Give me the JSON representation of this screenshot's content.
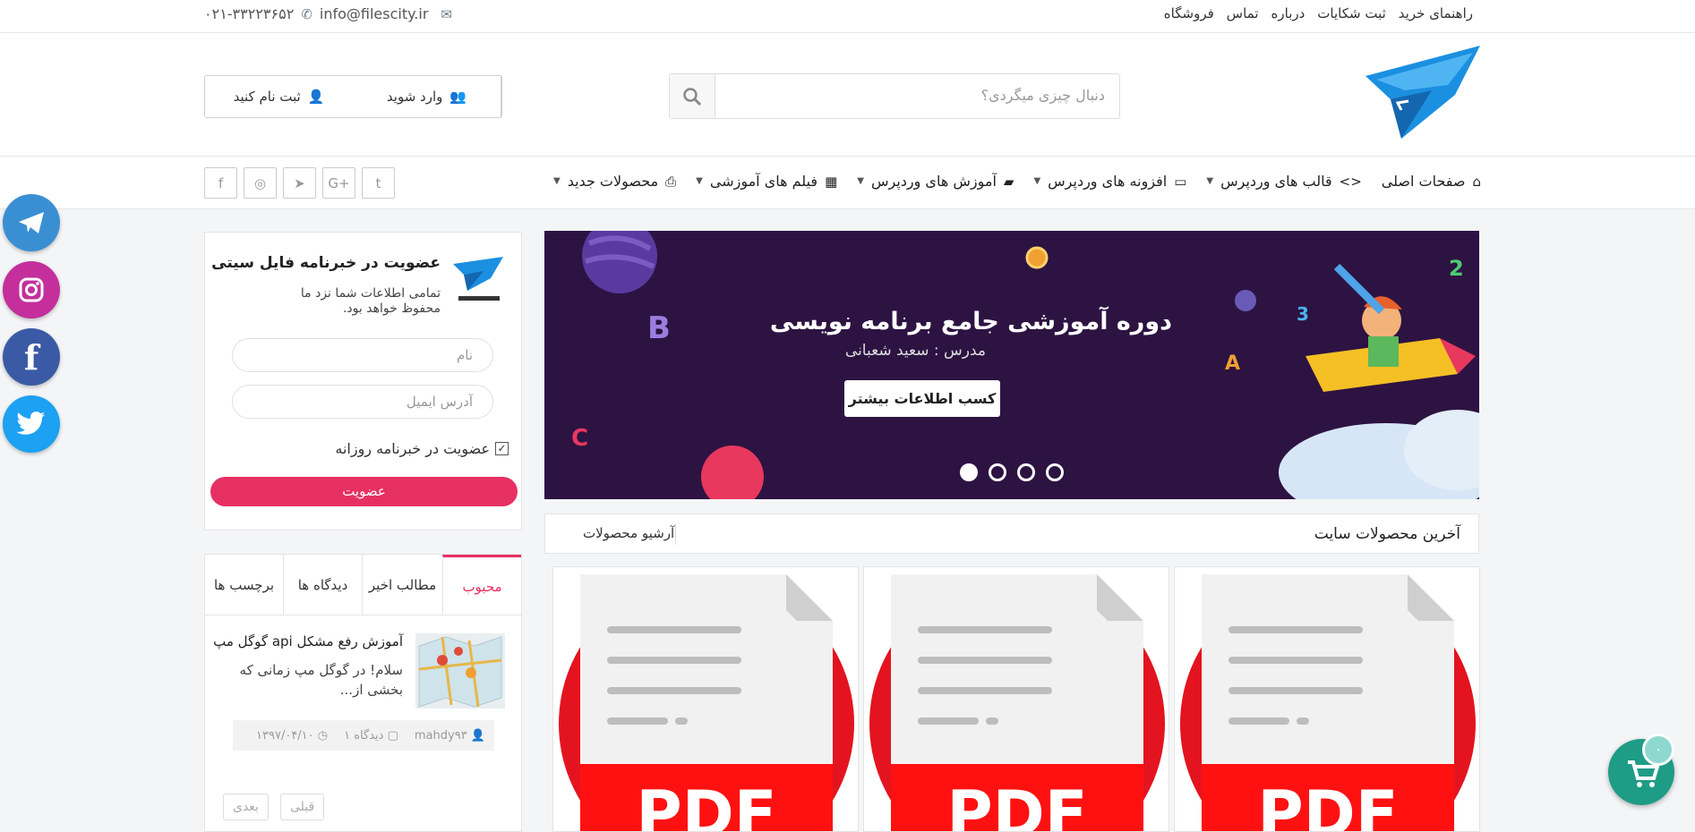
{
  "topbar": {
    "links": [
      "راهنمای خرید",
      "ثبت شکایات",
      "درباره",
      "تماس",
      "فروشگاه"
    ],
    "phone": "۰۲۱-۳۳۲۲۳۶۵۲",
    "email": "info@filescity.ir"
  },
  "header": {
    "search_placeholder": "دنبال چیزی میگردی؟",
    "login_label": "وارد شوید",
    "register_label": "ثبت نام کنید"
  },
  "nav": {
    "items": [
      {
        "label": "صفحات اصلی",
        "icon": "home-icon",
        "dropdown": false
      },
      {
        "label": "قالب های وردپرس",
        "icon": "code-icon",
        "dropdown": true
      },
      {
        "label": "افزونه های وردپرس",
        "icon": "folder-icon",
        "dropdown": true
      },
      {
        "label": "آموزش های وردپرس",
        "icon": "book-icon",
        "dropdown": true
      },
      {
        "label": "فیلم های آموزشی",
        "icon": "film-icon",
        "dropdown": true
      },
      {
        "label": "محصولات جدید",
        "icon": "print-icon",
        "dropdown": true
      }
    ],
    "social": [
      "twitter-icon",
      "google-plus-icon",
      "telegram-icon",
      "instagram-icon",
      "facebook-icon"
    ]
  },
  "floating_social": [
    {
      "icon": "telegram-icon",
      "color": "#3a8fd3"
    },
    {
      "icon": "instagram-icon",
      "color": "#c42f9c"
    },
    {
      "icon": "facebook-icon",
      "color": "#3b5aa5"
    },
    {
      "icon": "twitter-icon",
      "color": "#1da1f2"
    }
  ],
  "newsletter": {
    "title": "عضویت در خبرنامه فایل سیتی",
    "description": "تمامی اطلاعات شما نزد ما محفوظ خواهد بود.",
    "name_placeholder": "نام",
    "email_placeholder": "آدرس ایمیل",
    "checkbox_label": "عضویت در خبرنامه روزانه",
    "checkbox_checked": true,
    "submit_label": "عضویت",
    "accent": "#e73062"
  },
  "sidebar_tabs": {
    "tabs": [
      "محبوب",
      "مطالب اخیر",
      "دیدگاه ها",
      "برچسب ها"
    ],
    "active": 0
  },
  "post": {
    "title": "آموزش رفع مشکل api گوگل مپ",
    "excerpt": "سلام! در گوگل مپ زمانی که بخشی از...",
    "author": "mahdy۹۳",
    "comments": "دیدگاه ۱",
    "date": "۱۳۹۷/۰۴/۱۰",
    "prev_label": "قبلی",
    "next_label": "بعدی"
  },
  "slider": {
    "title": "دوره آموزشی جامع برنامه نویسی",
    "subtitle": "مدرس : سعید شعبانی",
    "button_label": "کسب اطلاعات بیشتر",
    "slide_count": 4,
    "active_slide": 0
  },
  "latest": {
    "title": "آخرین محصولات سایت",
    "archive_label": "آرشیو محصولات"
  },
  "cards": [
    {
      "label": "PDF"
    },
    {
      "label": "PDF"
    },
    {
      "label": "PDF"
    }
  ],
  "cart": {
    "count": "۰",
    "color": "#1e9c86"
  }
}
